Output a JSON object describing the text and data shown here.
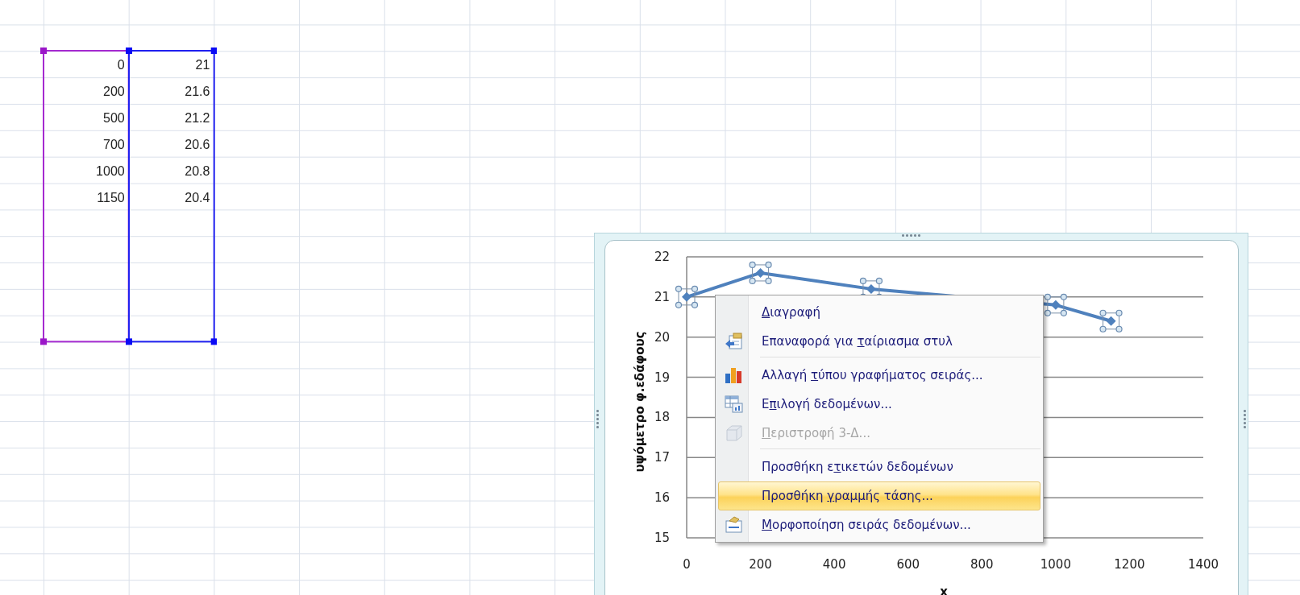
{
  "sheet": {
    "rows": [
      [
        "0",
        "21"
      ],
      [
        "200",
        "21.6"
      ],
      [
        "500",
        "21.2"
      ],
      [
        "700",
        "20.6"
      ],
      [
        "1000",
        "20.8"
      ],
      [
        "1150",
        "20.4"
      ]
    ]
  },
  "chart": {
    "selected": true,
    "chart_data": {
      "type": "line",
      "xlabel": "x",
      "ylabel": "υψόμετρο φ.εδάφους",
      "x": [
        0,
        200,
        500,
        700,
        1000,
        1150
      ],
      "grid": true,
      "series": [
        {
          "color": "#4f81bd",
          "marker": "diamond",
          "values": [
            21,
            21.6,
            21.2,
            null,
            20.8,
            20.4
          ]
        }
      ],
      "xlim": [
        0,
        1400
      ],
      "ylim": [
        15,
        22
      ],
      "xticks": [
        0,
        200,
        400,
        600,
        800,
        1000,
        1200,
        1400
      ],
      "yticks": [
        15,
        16,
        17,
        18,
        19,
        20,
        21,
        22
      ]
    }
  },
  "context_menu": {
    "items": [
      {
        "kind": "plain",
        "selected": false,
        "disabled": false,
        "parts": [
          {
            "text": "Δ",
            "underlined": true
          },
          {
            "text": "ιαγραφή",
            "underlined": false
          }
        ]
      },
      {
        "kind": "reset",
        "selected": false,
        "disabled": false,
        "parts": [
          {
            "text": "Επαναφορά για ",
            "underlined": false
          },
          {
            "text": "τ",
            "underlined": true
          },
          {
            "text": "αίριασμα στυλ",
            "underlined": false
          }
        ]
      },
      {
        "kind": "separator"
      },
      {
        "kind": "chart-type",
        "selected": false,
        "disabled": false,
        "parts": [
          {
            "text": "Αλλαγή ",
            "underlined": false
          },
          {
            "text": "τ",
            "underlined": true
          },
          {
            "text": "ύπου γραφήματος σειράς...",
            "underlined": false
          }
        ]
      },
      {
        "kind": "data",
        "selected": false,
        "disabled": false,
        "parts": [
          {
            "text": "Ε",
            "underlined": false
          },
          {
            "text": "π",
            "underlined": true
          },
          {
            "text": "ιλογή δεδομένων...",
            "underlined": false
          }
        ]
      },
      {
        "kind": "rotate",
        "selected": false,
        "disabled": true,
        "parts": [
          {
            "text": "Π",
            "underlined": true
          },
          {
            "text": "εριστροφή 3-Δ...",
            "underlined": false
          }
        ]
      },
      {
        "kind": "separator"
      },
      {
        "kind": "plain",
        "selected": false,
        "disabled": false,
        "parts": [
          {
            "text": "Προσθήκη ε",
            "underlined": false
          },
          {
            "text": "τ",
            "underlined": true
          },
          {
            "text": "ικετών δεδομένων",
            "underlined": false
          }
        ]
      },
      {
        "kind": "plain",
        "selected": true,
        "disabled": false,
        "parts": [
          {
            "text": "Προσθήκη ",
            "underlined": false
          },
          {
            "text": "γ",
            "underlined": true
          },
          {
            "text": "ραμμής τάσης...",
            "underlined": false
          }
        ]
      },
      {
        "kind": "format",
        "selected": false,
        "disabled": false,
        "parts": [
          {
            "text": "Μ",
            "underlined": true
          },
          {
            "text": "ορφοποίηση σειράς δεδομένων...",
            "underlined": false
          }
        ]
      }
    ]
  }
}
